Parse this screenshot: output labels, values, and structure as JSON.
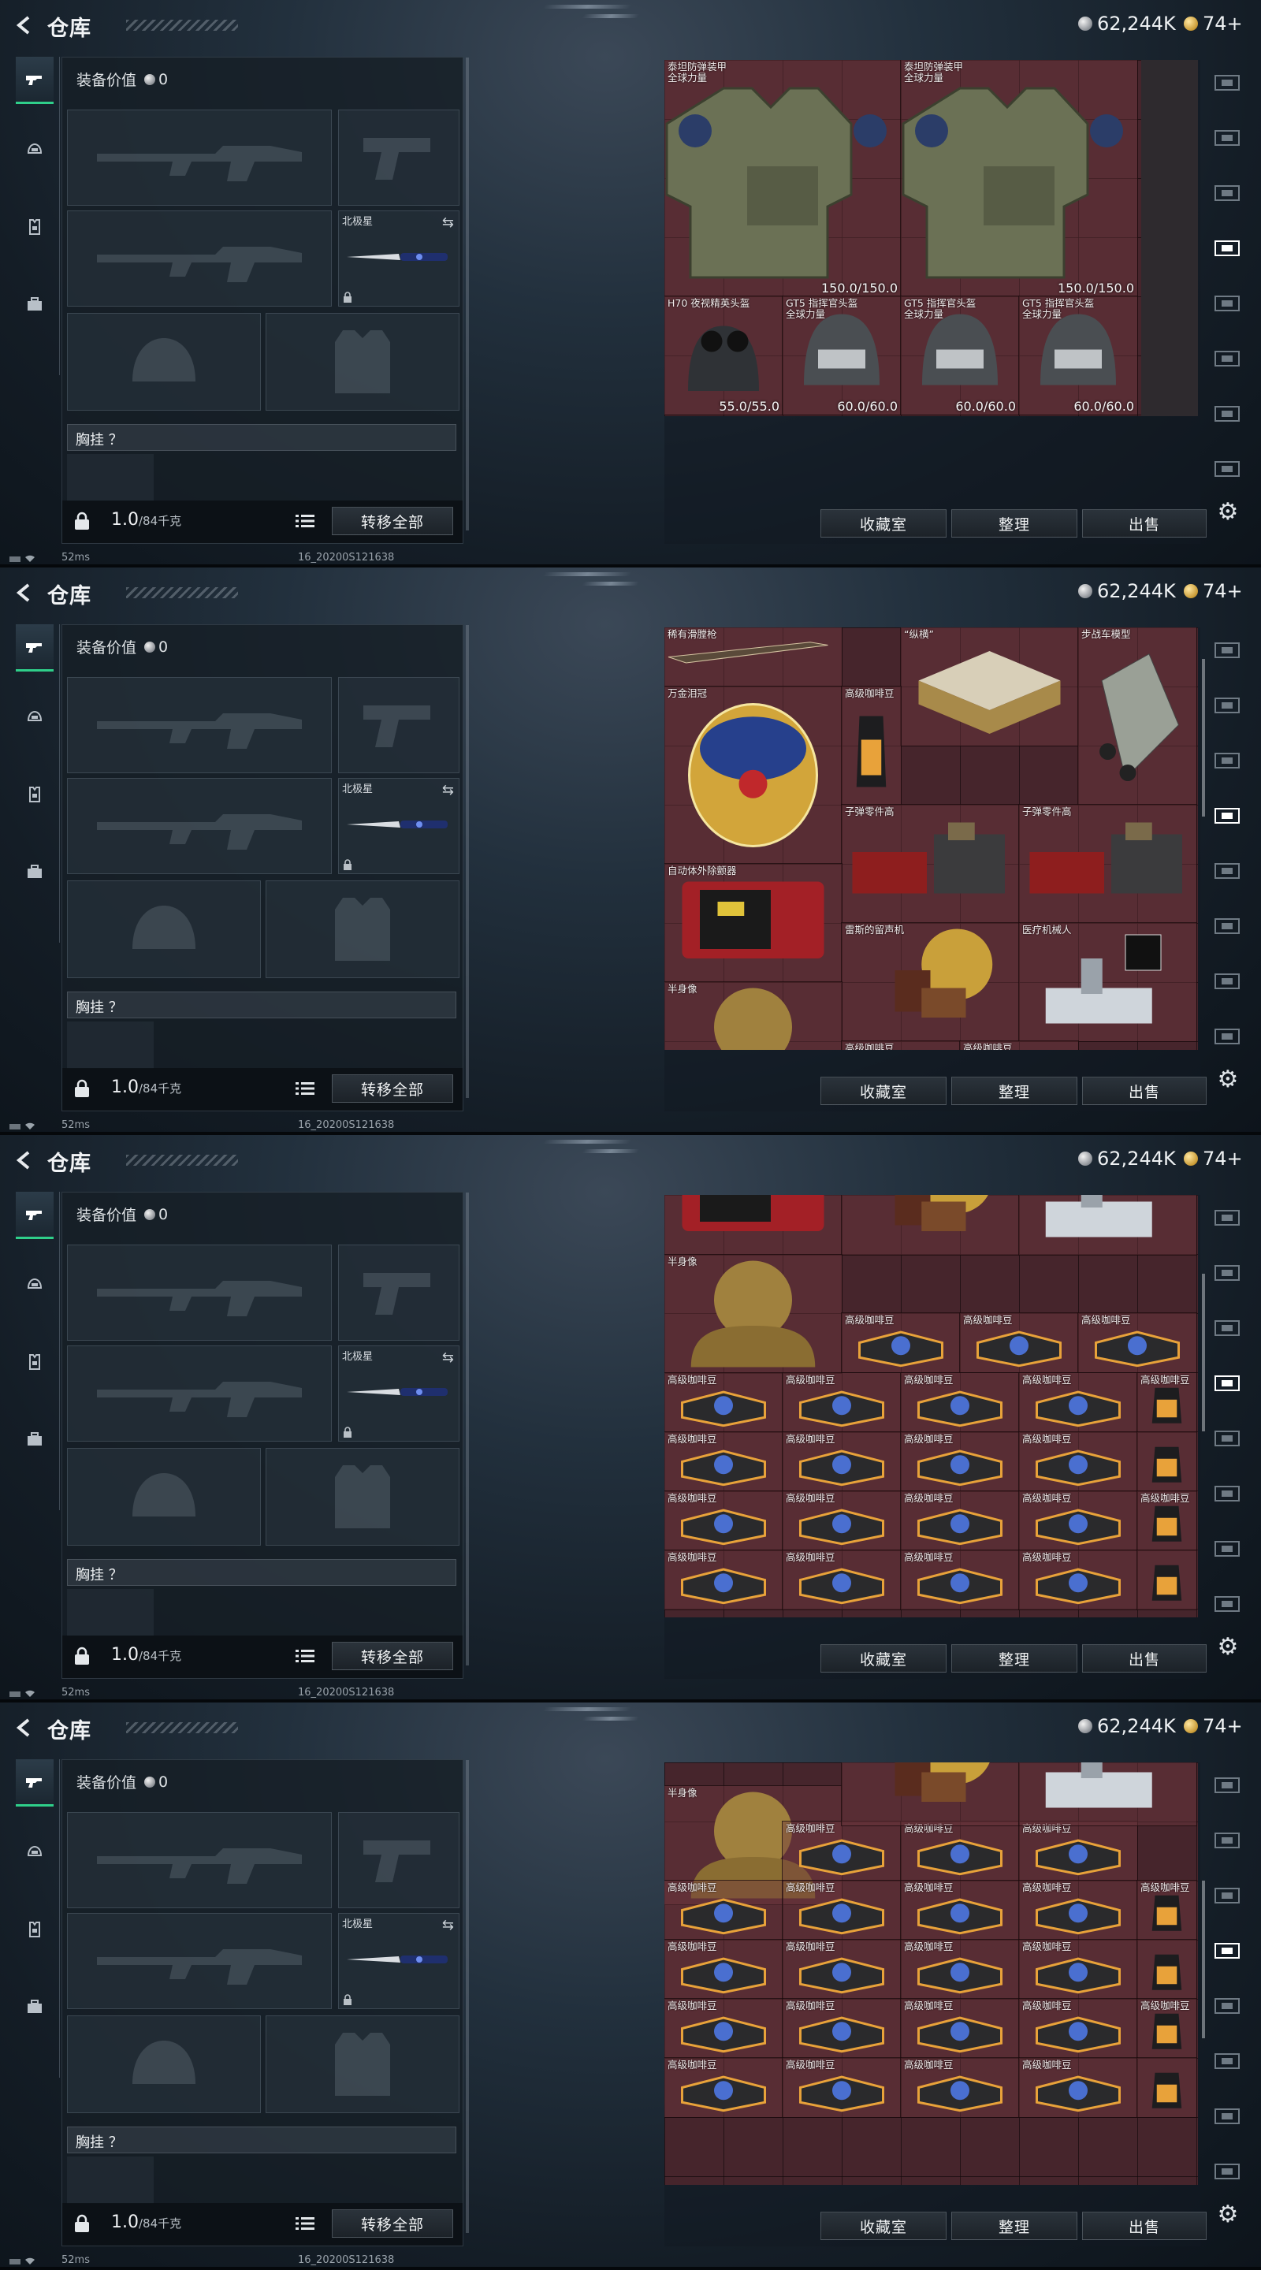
{
  "header": {
    "title": "仓库",
    "currency_silver": "62,244K",
    "currency_gold": "74+"
  },
  "loadout": {
    "value_label": "装备价值",
    "value": "0",
    "melee_label": "北极星",
    "chest_label": "胸挂 ？",
    "weight": "1.0",
    "weight_max": "/84千克",
    "transfer_all": "转移全部"
  },
  "storage_buttons": {
    "collection": "收藏室",
    "sort": "整理",
    "sell": "出售"
  },
  "status": {
    "ping": "52ms",
    "build": "16_20200S121638"
  },
  "icons": {
    "back": "back-arrow-icon",
    "tabs": [
      "gun-icon",
      "helmet-icon",
      "vest-icon",
      "backpack-icon"
    ],
    "right": [
      "hideout-icon",
      "storage-ii-icon",
      "storage-iii-icon",
      "storage-iv-active-icon",
      "storage-v-icon",
      "storage-vi-icon",
      "storage-vii-icon",
      "storage-viii-icon"
    ],
    "settings": "gear-icon"
  },
  "panels": [
    {
      "items": [
        {
          "name": "泰坦防弹装甲\n全球力量",
          "durability": "150.0/150.0"
        },
        {
          "name": "泰坦防弹装甲\n全球力量",
          "durability": "150.0/150.0"
        },
        {
          "name": "H70 夜视精英头盔",
          "durability": "55.0/55.0"
        },
        {
          "name": "GT5 指挥官头盔\n全球力量",
          "durability": "60.0/60.0"
        },
        {
          "name": "GT5 指挥官头盔\n全球力量",
          "durability": "60.0/60.0"
        },
        {
          "name": "GT5 指挥官头盔\n全球力量",
          "durability": "60.0/60.0"
        }
      ]
    },
    {
      "items": [
        {
          "name": "稀有滑膛枪"
        },
        {
          "name": "“纵横”"
        },
        {
          "name": "步战车模型"
        },
        {
          "name": "万金泪冠"
        },
        {
          "name": "高级咖啡豆"
        },
        {
          "name": "子弹零件高"
        },
        {
          "name": "子弹零件高"
        },
        {
          "name": "自动体外除颤器"
        },
        {
          "name": "雷斯的留声机"
        },
        {
          "name": "医疗机械人"
        },
        {
          "name": "半身像"
        },
        {
          "name": "高级咖啡豆"
        },
        {
          "name": "高级咖啡豆"
        }
      ]
    },
    {
      "top_items": [
        {
          "name": "雷斯的留声机"
        },
        {
          "name": "医疗机械人"
        },
        {
          "name": "半身像"
        },
        {
          "name": "高级咖啡豆"
        },
        {
          "name": "高级咖啡豆"
        },
        {
          "name": "高级咖啡豆"
        }
      ],
      "coffee_label": "高级咖啡豆"
    },
    {
      "top_items": [
        {
          "name": "半身像"
        },
        {
          "name": "高级咖啡豆"
        },
        {
          "name": "高级咖啡豆"
        },
        {
          "name": "高级咖啡豆"
        }
      ],
      "coffee_label": "高级咖啡豆"
    }
  ]
}
